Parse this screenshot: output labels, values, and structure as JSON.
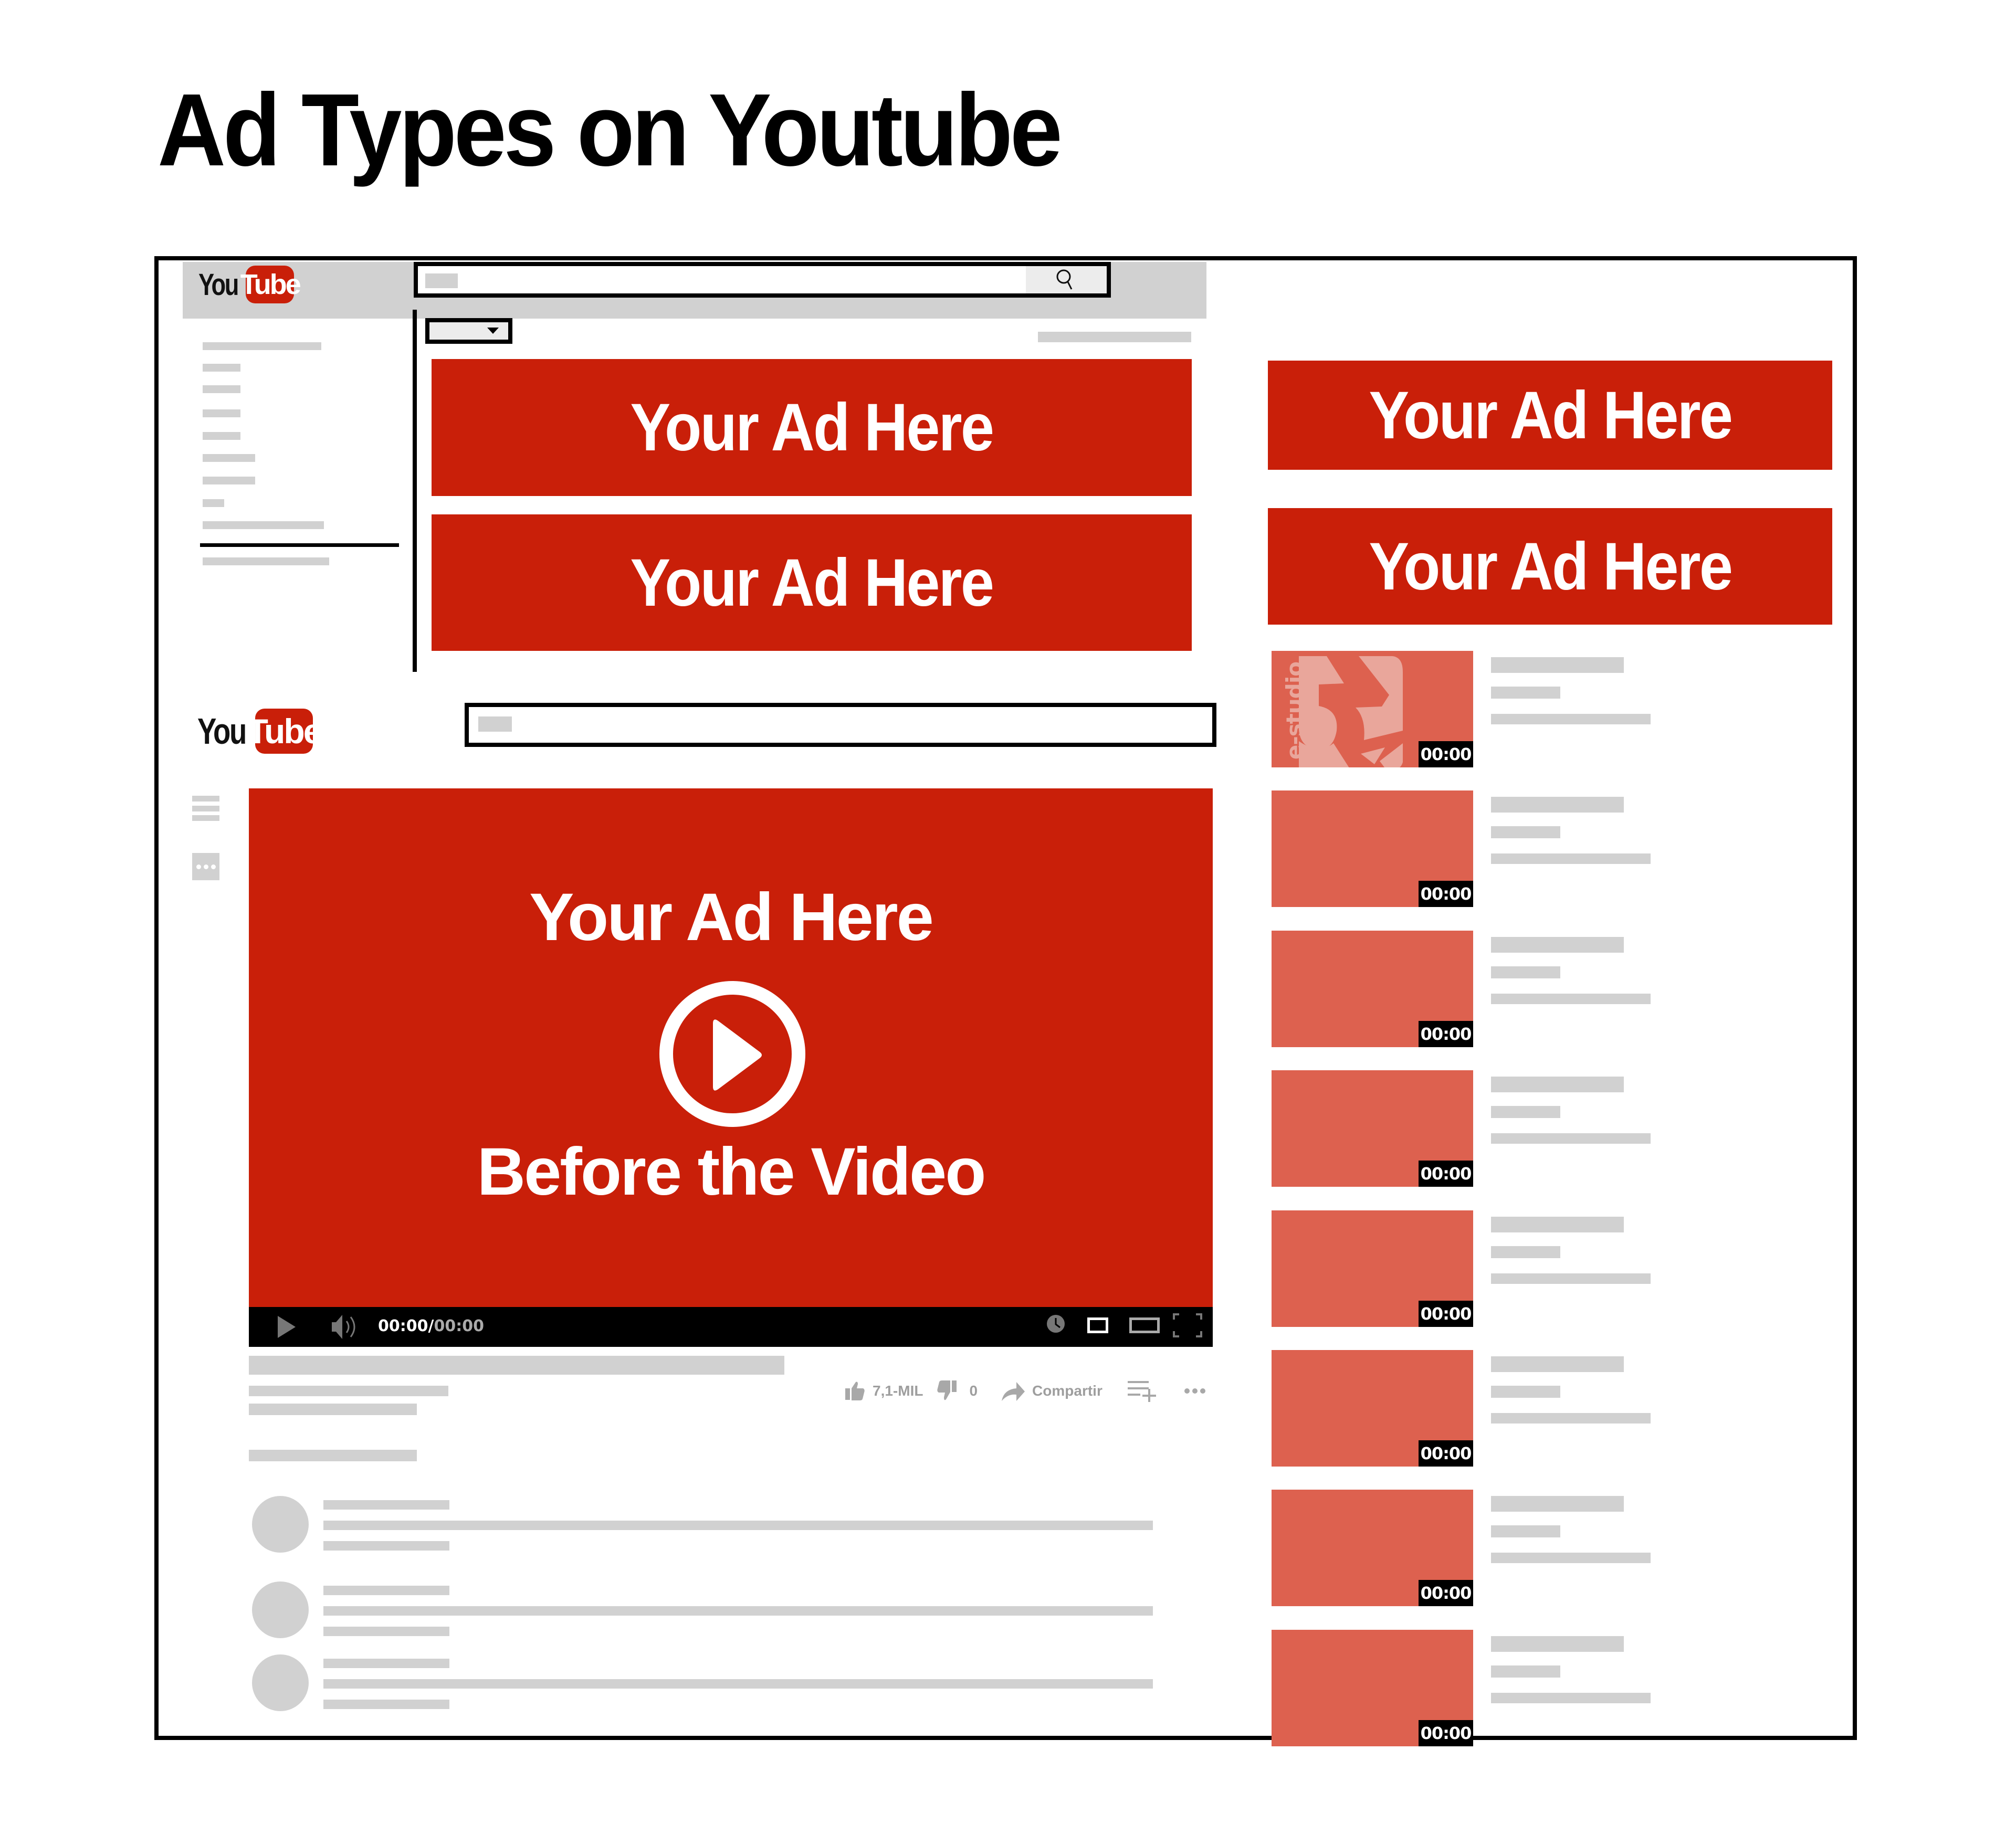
{
  "page": {
    "title": "Ad Types on Youtube"
  },
  "colors": {
    "ad_red": "#c91f09",
    "thumb_red": "#dd614f",
    "placeholder_gray": "#d1d1d1",
    "control_bar": "#000000"
  },
  "top_screen": {
    "logo": {
      "you": "You",
      "tube": "Tube"
    },
    "search": {
      "icon": "search-icon"
    },
    "sort_dropdown": {
      "icon": "caret-down-icon"
    },
    "ads": [
      {
        "label": "Your Ad Here"
      },
      {
        "label": "Your Ad Here"
      }
    ]
  },
  "side_ads": [
    {
      "label": "Your Ad Here"
    },
    {
      "label": "Your Ad Here"
    }
  ],
  "watch_screen": {
    "logo": {
      "you": "You",
      "tube": "Tube"
    },
    "video_ad": {
      "headline": "Your Ad Here",
      "subline": "Before the Video",
      "icon": "play-circle-icon"
    },
    "controls": {
      "current_time": "00:00",
      "separator": "/",
      "total_time": "00:00",
      "icons": [
        "play-icon",
        "volume-icon",
        "clock-icon",
        "miniplayer-icon",
        "theater-mode-icon",
        "fullscreen-icon"
      ]
    },
    "actions": {
      "likes": "7,1-MIL",
      "dislikes": "0",
      "share": "Compartir",
      "icons": [
        "thumbs-up-icon",
        "thumbs-down-icon",
        "share-icon",
        "add-to-playlist-icon",
        "more-icon"
      ]
    }
  },
  "related_videos": [
    {
      "duration": "00:00",
      "thumbnail": "e-studio-logo"
    },
    {
      "duration": "00:00"
    },
    {
      "duration": "00:00"
    },
    {
      "duration": "00:00"
    },
    {
      "duration": "00:00"
    },
    {
      "duration": "00:00"
    },
    {
      "duration": "00:00"
    },
    {
      "duration": "00:00"
    }
  ],
  "thumbnail_logo_text": "e-studio",
  "comments_count": 3
}
